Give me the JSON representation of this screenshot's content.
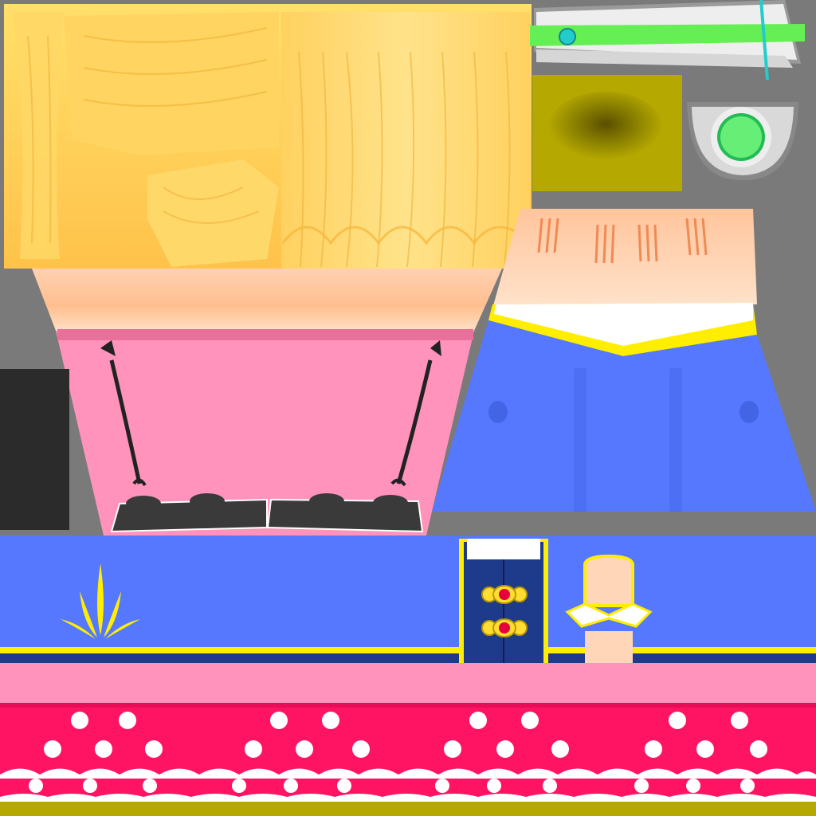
{
  "atlas": {
    "background": "#7a7a7a",
    "colors": {
      "hair": "#ffc84a",
      "hair_light": "#ffe58a",
      "skin": "#ffd6b8",
      "skin_shadow": "#ffb07a",
      "pink": "#ff93bb",
      "pink_dark": "#e8709b",
      "magenta": "#ff1464",
      "blue": "#5578ff",
      "navy": "#1e3a8a",
      "yellow": "#ffee00",
      "olive": "#b5a800",
      "green": "#66ee55",
      "teal": "#22cccc",
      "white": "#ffffff",
      "dark": "#2b2b2b"
    },
    "regions": [
      {
        "name": "hair-texture",
        "icon": "hair-strands"
      },
      {
        "name": "hair-clip-texture",
        "icon": "clip"
      },
      {
        "name": "olive-shadow-texture",
        "icon": "blob-shadow"
      },
      {
        "name": "round-clip-texture",
        "icon": "ring-gem"
      },
      {
        "name": "pink-bodice-texture",
        "icon": "bodice-laces"
      },
      {
        "name": "blue-skirt-texture",
        "icon": "skirt-pleats"
      },
      {
        "name": "dark-swatch",
        "icon": "solid-fill"
      },
      {
        "name": "blue-sleeve-band",
        "icon": "leaf-emblem"
      },
      {
        "name": "navy-vest-buttons",
        "icon": "gem-buttons"
      },
      {
        "name": "collar-neck",
        "icon": "collar"
      },
      {
        "name": "pink-stripe",
        "icon": "solid-fill"
      },
      {
        "name": "polka-dot-ruffle",
        "icon": "polka-dots"
      }
    ]
  }
}
